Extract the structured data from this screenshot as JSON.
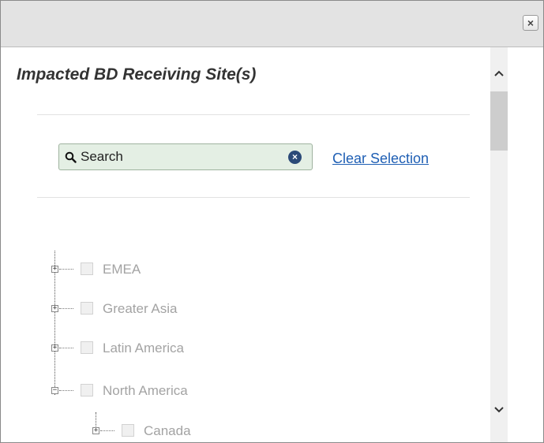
{
  "dialog": {
    "heading": "Impacted BD Receiving Site(s)",
    "close_glyph": "×"
  },
  "search": {
    "value": "Search",
    "icon": "search-icon",
    "clear_glyph": "×"
  },
  "clear_selection_label": "Clear Selection",
  "tree": {
    "nodes": [
      {
        "label": "EMEA",
        "expander": "+",
        "level": 0,
        "checked": false
      },
      {
        "label": "Greater Asia",
        "expander": "+",
        "level": 0,
        "checked": false
      },
      {
        "label": "Latin America",
        "expander": "+",
        "level": 0,
        "checked": false
      },
      {
        "label": "North America",
        "expander": "−",
        "level": 0,
        "checked": false
      },
      {
        "label": "Canada",
        "expander": "+",
        "level": 1,
        "checked": false
      }
    ]
  },
  "colors": {
    "titlebar": "#e3e3e3",
    "search_background": "#e4efe4",
    "link": "#1f5fb4",
    "disabled_text": "#a3a3a3",
    "clear_icon": "#2b4a78"
  }
}
